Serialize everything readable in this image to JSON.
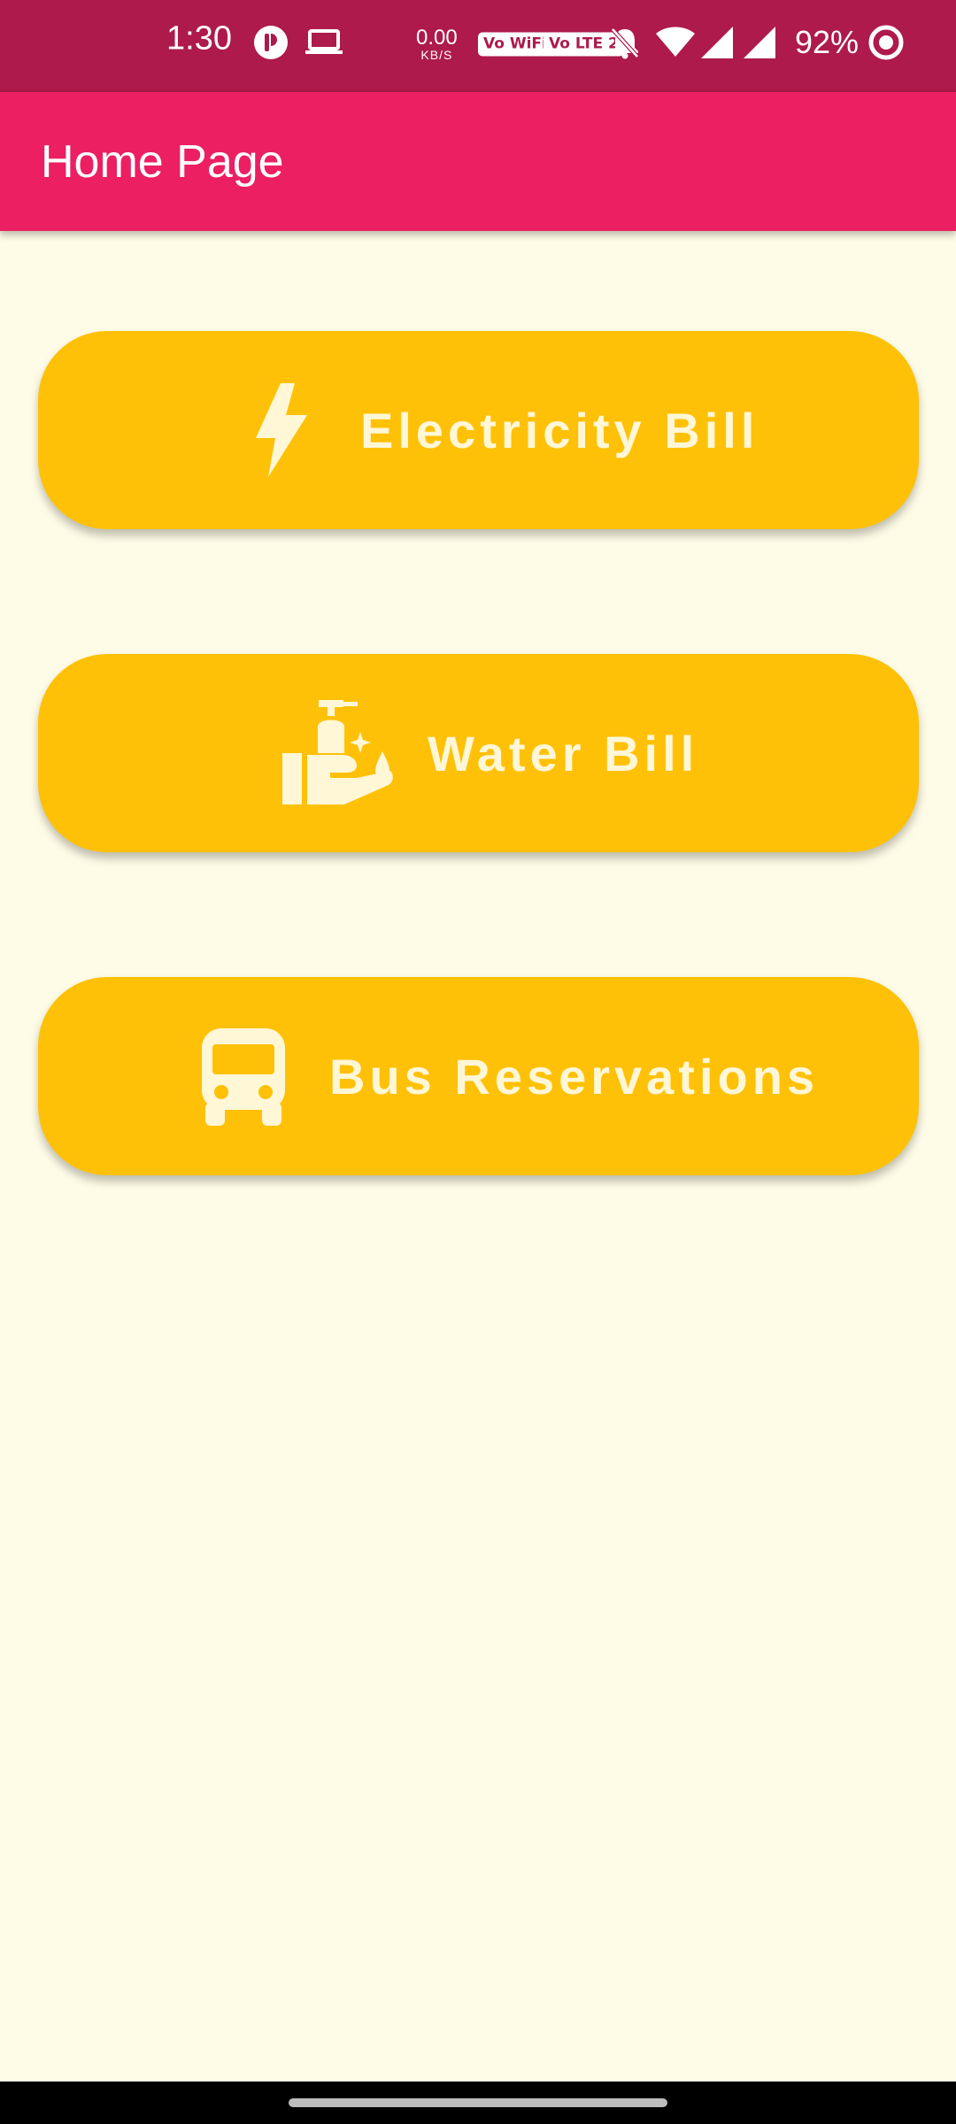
{
  "status_bar": {
    "time": "1:30",
    "net_speed_value": "0.00",
    "net_speed_unit": "KB/S",
    "sim1_badge": "Vo WiFi 1",
    "sim2_badge": "Vo LTE 2",
    "battery": "92%",
    "icons": [
      "app-notification-icon",
      "laptop-icon",
      "bell-off-icon",
      "wifi-icon",
      "signal-icon",
      "signal-icon",
      "battery-ring-icon"
    ]
  },
  "app_bar": {
    "title": "Home Page"
  },
  "menu": {
    "items": [
      {
        "label": "Electricity Bill",
        "icon": "lightning-bolt-icon"
      },
      {
        "label": "Water Bill",
        "icon": "hand-soap-icon"
      },
      {
        "label": "Bus Reservations",
        "icon": "bus-icon"
      }
    ]
  },
  "colors": {
    "status_bar": "#AD1A4B",
    "app_bar": "#EC1F63",
    "background": "#FEFCE6",
    "button": "#FFC107",
    "button_text": "#FFF7D6"
  }
}
